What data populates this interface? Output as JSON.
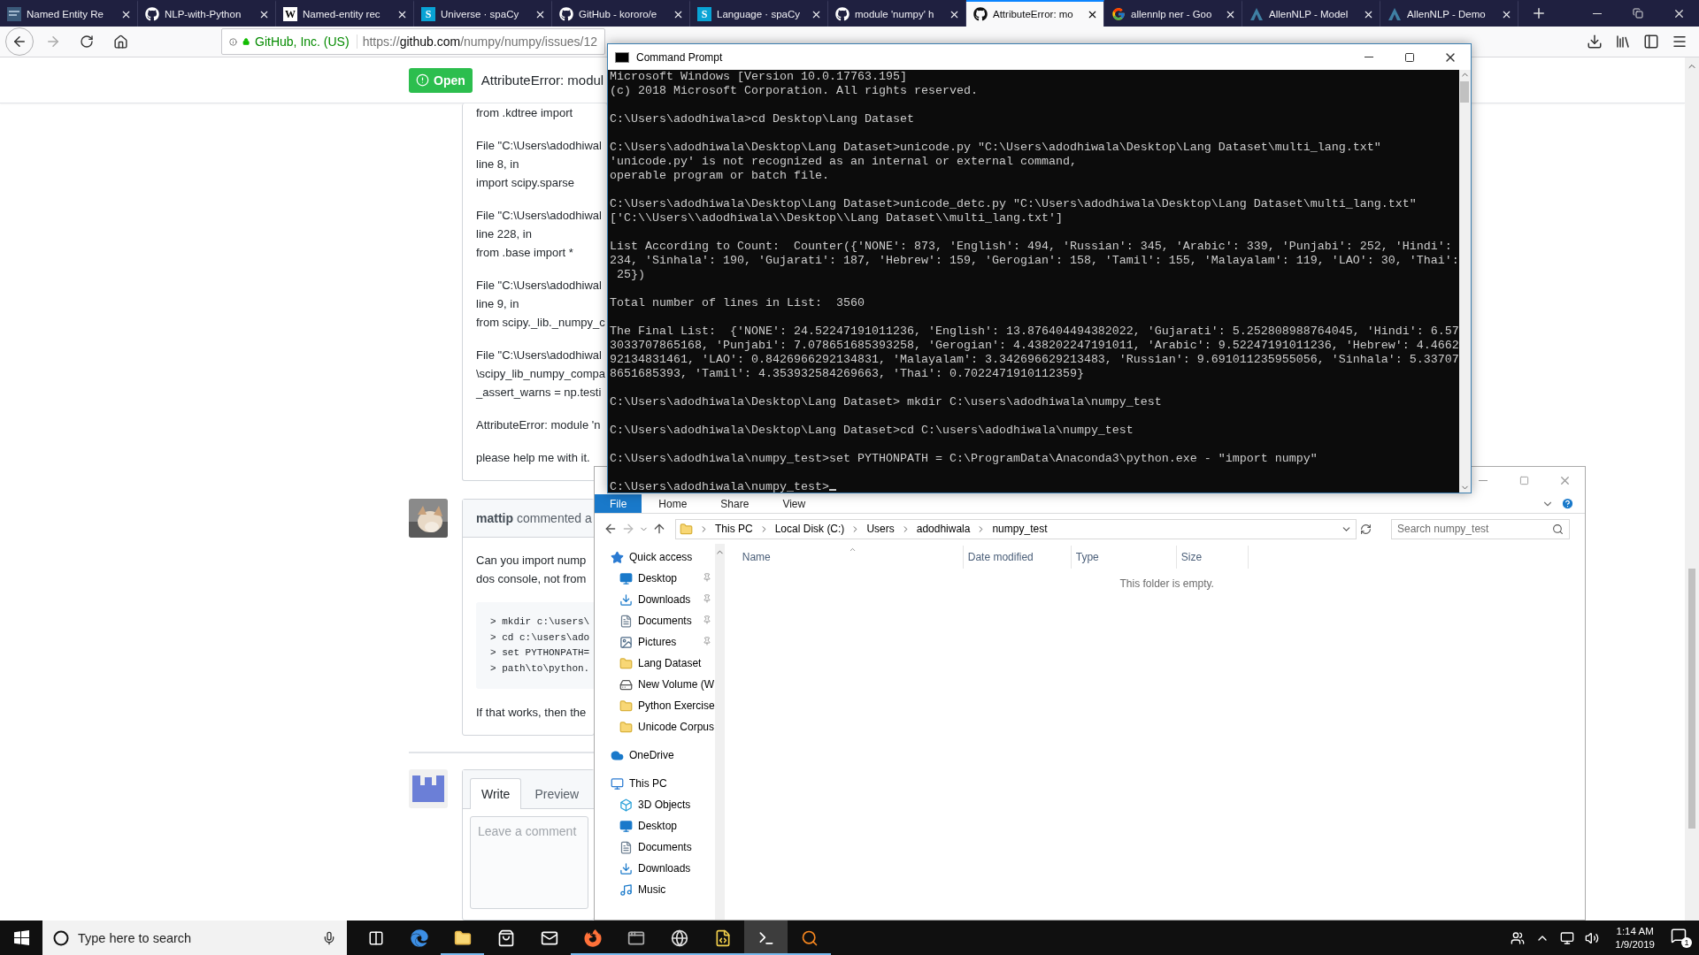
{
  "browser": {
    "tabs": [
      {
        "label": "Named Entity Re",
        "kind": "thumbnail",
        "selected": false
      },
      {
        "label": "NLP-with-Python",
        "kind": "github",
        "selected": false
      },
      {
        "label": "Named-entity rec",
        "kind": "letter",
        "letter": "W",
        "selected": false
      },
      {
        "label": "Universe · spaCy",
        "kind": "letter",
        "letter": "S",
        "selected": false
      },
      {
        "label": "GitHub - kororo/e",
        "kind": "github",
        "selected": false
      },
      {
        "label": "Language · spaCy",
        "kind": "letter",
        "letter": "S",
        "selected": false
      },
      {
        "label": "module 'numpy' h",
        "kind": "github",
        "selected": false
      },
      {
        "label": "AttributeError: mo",
        "kind": "github",
        "selected": true
      },
      {
        "label": "allennlp ner - Goo",
        "kind": "google",
        "selected": false
      },
      {
        "label": "AllenNLP - Model",
        "kind": "allennlp",
        "selected": false
      },
      {
        "label": "AllenNLP - Demo",
        "kind": "allennlp",
        "selected": false
      }
    ],
    "address": {
      "identity": "GitHub, Inc. (US)",
      "scheme": "https://",
      "host": "github.com",
      "path": "/numpy/numpy/issues/12"
    },
    "issue": {
      "state": "Open",
      "title": "AttributeError: modul"
    },
    "comment_paragraphs": [
      [
        "from .kdtree import"
      ],
      [
        "File \"C:\\Users\\adodhiwal",
        "line 8, in",
        "import scipy.sparse"
      ],
      [
        "File \"C:\\Users\\adodhiwal",
        "line 228, in",
        "from .base import *"
      ],
      [
        "File \"C:\\Users\\adodhiwal",
        "line 9, in",
        "from scipy._lib._numpy_c"
      ],
      [
        "File \"C:\\Users\\adodhiwal",
        "\\scipy_lib_numpy_compa",
        "_assert_warns = np.testi"
      ],
      [
        "AttributeError: module 'n"
      ],
      [
        "please help me with it."
      ]
    ],
    "reply": {
      "author": "mattip",
      "action": "commented a",
      "paragraph": [
        "Can you import nump",
        "dos console, not from"
      ],
      "code": [
        "> mkdir c:\\users\\",
        "> cd c:\\users\\ado",
        "> set PYTHONPATH=",
        "> path\\to\\python."
      ],
      "after": "If that works, then the"
    },
    "composer": {
      "tabs": [
        {
          "label": "Write",
          "selected": true
        },
        {
          "label": "Preview",
          "selected": false
        }
      ],
      "placeholder": "Leave a comment"
    }
  },
  "console": {
    "title": "Command Prompt",
    "blocks": [
      [
        "Microsoft Windows [Version 10.0.17763.195]",
        "(c) 2018 Microsoft Corporation. All rights reserved."
      ],
      [
        "C:\\Users\\adodhiwala>cd Desktop\\Lang Dataset"
      ],
      [
        "C:\\Users\\adodhiwala\\Desktop\\Lang Dataset>unicode.py \"C:\\Users\\adodhiwala\\Desktop\\Lang Dataset\\multi_lang.txt\"",
        "'unicode.py' is not recognized as an internal or external command,",
        "operable program or batch file."
      ],
      [
        "C:\\Users\\adodhiwala\\Desktop\\Lang Dataset>unicode_detc.py \"C:\\Users\\adodhiwala\\Desktop\\Lang Dataset\\multi_lang.txt\"",
        "['C:\\\\Users\\\\adodhiwala\\\\Desktop\\\\Lang Dataset\\\\multi_lang.txt']"
      ],
      [
        "List According to Count:  Counter({'NONE': 873, 'English': 494, 'Russian': 345, 'Arabic': 339, 'Punjabi': 252, 'Hindi':",
        "234, 'Sinhala': 190, 'Gujarati': 187, 'Hebrew': 159, 'Gerogian': 158, 'Tamil': 155, 'Malayalam': 119, 'LAO': 30, 'Thai':",
        " 25})"
      ],
      [
        "Total number of lines in List:  3560"
      ],
      [
        "The Final List:  {'NONE': 24.52247191011236, 'English': 13.876404494382022, 'Gujarati': 5.252808988764045, 'Hindi': 6.57",
        "3033707865168, 'Punjabi': 7.078651685393258, 'Gerogian': 4.438202247191011, 'Arabic': 9.52247191011236, 'Hebrew': 4.4662",
        "92134831461, 'LAO': 0.8426966292134831, 'Malayalam': 3.342696629213483, 'Russian': 9.691011235955056, 'Sinhala': 5.33707",
        "8651685393, 'Tamil': 4.353932584269663, 'Thai': 0.7022471910112359}"
      ],
      [
        "C:\\Users\\adodhiwala\\Desktop\\Lang Dataset> mkdir C:\\users\\adodhiwala\\numpy_test"
      ],
      [
        "C:\\Users\\adodhiwala\\Desktop\\Lang Dataset>cd C:\\users\\adodhiwala\\numpy_test"
      ],
      [
        "C:\\Users\\adodhiwala\\numpy_test>set PYTHONPATH = C:\\ProgramData\\Anaconda3\\python.exe - \"import numpy\""
      ]
    ],
    "prompt": "C:\\Users\\adodhiwala\\numpy_test>"
  },
  "explorer": {
    "ribbon_tabs": [
      {
        "label": "File",
        "kind": "menu"
      },
      {
        "label": "Home",
        "kind": "tab"
      },
      {
        "label": "Share",
        "kind": "tab"
      },
      {
        "label": "View",
        "kind": "tab"
      }
    ],
    "breadcrumb": [
      "This PC",
      "Local Disk (C:)",
      "Users",
      "adodhiwala",
      "numpy_test"
    ],
    "search": {
      "placeholder": "Search numpy_test"
    },
    "nav": [
      {
        "label": "Quick access",
        "kind": "star",
        "children": [
          {
            "label": "Desktop",
            "kind": "desktop",
            "pinned": true
          },
          {
            "label": "Downloads",
            "kind": "download",
            "pinned": true
          },
          {
            "label": "Documents",
            "kind": "document",
            "pinned": true
          },
          {
            "label": "Pictures",
            "kind": "picture",
            "pinned": true
          },
          {
            "label": "Lang Dataset",
            "kind": "folder",
            "pinned": false
          },
          {
            "label": "New Volume (W",
            "kind": "drive",
            "pinned": false
          },
          {
            "label": "Python Exercise",
            "kind": "folder",
            "pinned": false
          },
          {
            "label": "Unicode Corpus",
            "kind": "folder",
            "pinned": false
          }
        ]
      },
      {
        "label": "OneDrive",
        "kind": "cloud"
      },
      {
        "label": "This PC",
        "kind": "pc",
        "children": [
          {
            "label": "3D Objects",
            "kind": "cube",
            "pinned": false
          },
          {
            "label": "Desktop",
            "kind": "desktop",
            "pinned": false
          },
          {
            "label": "Documents",
            "kind": "document",
            "pinned": false
          },
          {
            "label": "Downloads",
            "kind": "download",
            "pinned": false
          },
          {
            "label": "Music",
            "kind": "music",
            "pinned": false
          }
        ]
      }
    ],
    "columns": [
      "Name",
      "Date modified",
      "Type",
      "Size"
    ],
    "empty_message": "This folder is empty."
  },
  "taskbar": {
    "search": {
      "placeholder": "Type here to search"
    },
    "apps": [
      {
        "kind": "task-view",
        "running": false,
        "selected": false
      },
      {
        "kind": "edge",
        "running": false,
        "selected": false
      },
      {
        "kind": "folder",
        "running": true,
        "selected": false
      },
      {
        "kind": "store",
        "running": false,
        "selected": false
      },
      {
        "kind": "mail",
        "running": false,
        "selected": false
      },
      {
        "kind": "firefox",
        "running": true,
        "selected": false
      },
      {
        "kind": "window",
        "running": true,
        "selected": false
      },
      {
        "kind": "web",
        "running": true,
        "selected": false
      },
      {
        "kind": "python",
        "running": true,
        "selected": false
      },
      {
        "kind": "terminal",
        "running": true,
        "selected": true
      },
      {
        "kind": "search",
        "running": true,
        "selected": false
      }
    ],
    "time": "1:14 AM",
    "date": "1/9/2019",
    "notifications": "1"
  }
}
